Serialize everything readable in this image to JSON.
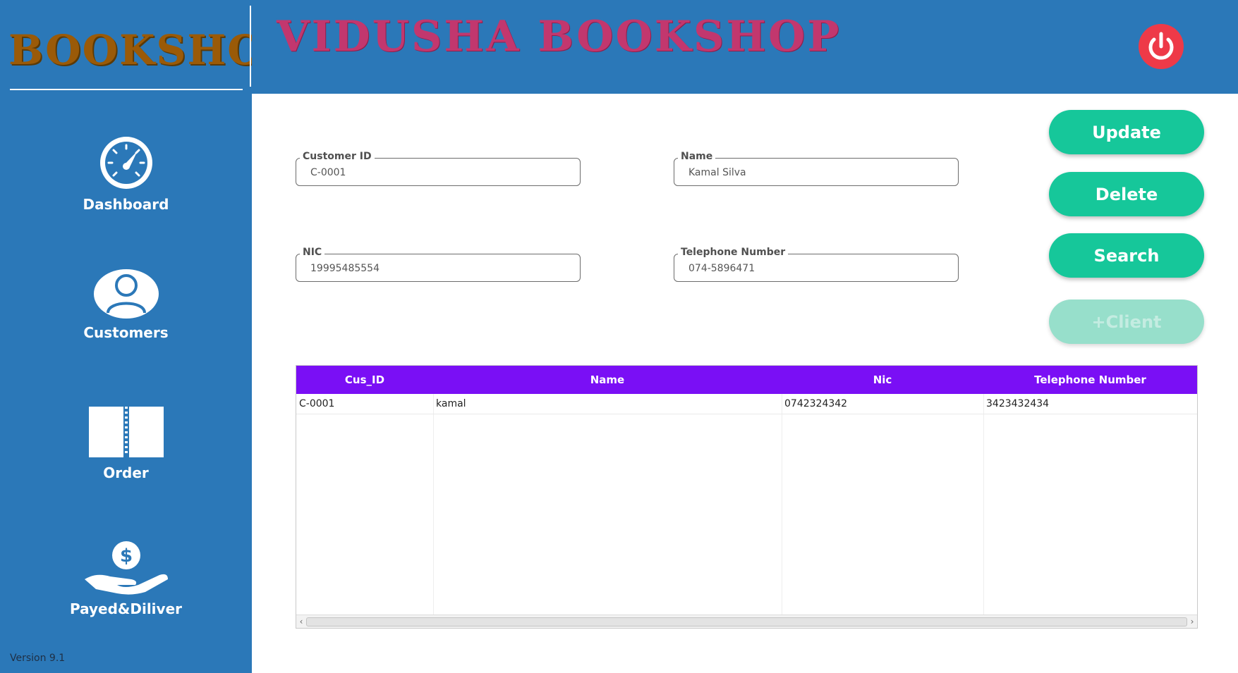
{
  "sidebar": {
    "logo_text": "BOOKSHOP",
    "items": [
      {
        "label": "Dashboard",
        "icon": "speedometer-icon"
      },
      {
        "label": "Customers",
        "icon": "user-icon"
      },
      {
        "label": "Order",
        "icon": "book-icon"
      },
      {
        "label": "Payed&Diliver",
        "icon": "money-hand-icon"
      }
    ],
    "version": "Version 9.1"
  },
  "header": {
    "title": "VIDUSHA BOOKSHOP",
    "power_icon": "power-icon"
  },
  "form": {
    "customer_id": {
      "label": "Customer ID",
      "value": "C-0001"
    },
    "name": {
      "label": "Name",
      "value": "Kamal Silva"
    },
    "nic": {
      "label": "NIC",
      "value": "19995485554"
    },
    "telephone": {
      "label": "Telephone Number",
      "value": "074-5896471"
    }
  },
  "actions": {
    "update": "Update",
    "delete": "Delete",
    "search": "Search",
    "add_client": "+Client"
  },
  "table": {
    "columns": [
      "Cus_ID",
      "Name",
      "Nic",
      "Telephone Number"
    ],
    "rows": [
      [
        "C-0001",
        "kamal",
        "0742324342",
        "3423432434"
      ]
    ]
  },
  "colors": {
    "sidebar_bg": "#2b78b8",
    "accent_green": "#16c79a",
    "table_header": "#7a0ff5",
    "power_red": "#ee3a48",
    "title_pink": "#c2376e",
    "logo_brown": "#9a5a08"
  }
}
